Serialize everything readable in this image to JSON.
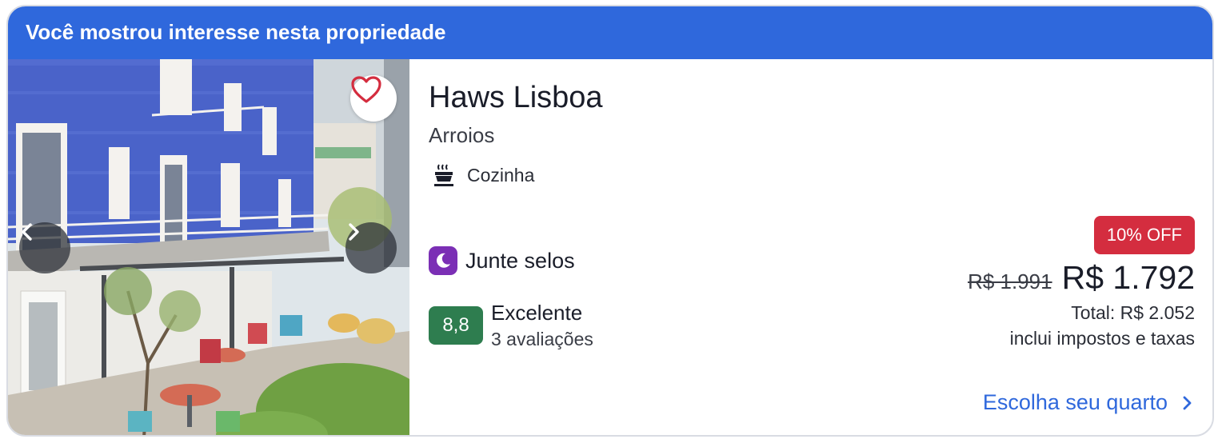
{
  "banner": {
    "text": "Você mostrou interesse nesta propriedade"
  },
  "property": {
    "name": "Haws Lisboa",
    "location": "Arroios",
    "amenity": {
      "icon": "kitchen-pot-icon",
      "label": "Cozinha"
    }
  },
  "stamps": {
    "icon": "moon-icon",
    "label": "Junte selos"
  },
  "rating": {
    "score": "8,8",
    "label": "Excelente",
    "count": "3 avaliações"
  },
  "pricing": {
    "discount_badge": "10% OFF",
    "old_price": "R$ 1.991",
    "new_price": "R$ 1.792",
    "total": "Total: R$ 2.052",
    "taxes_note": "inclui impostos e taxas"
  },
  "cta": {
    "label": "Escolha seu quarto",
    "icon": "chevron-right-icon"
  },
  "photo": {
    "favorite_icon": "heart-icon",
    "prev_icon": "chevron-left-icon",
    "next_icon": "chevron-right-icon"
  },
  "colors": {
    "brand": "#2f68dc",
    "discount": "#d42d3f",
    "rating": "#2e7d4f",
    "stamps": "#7b2fb5"
  }
}
